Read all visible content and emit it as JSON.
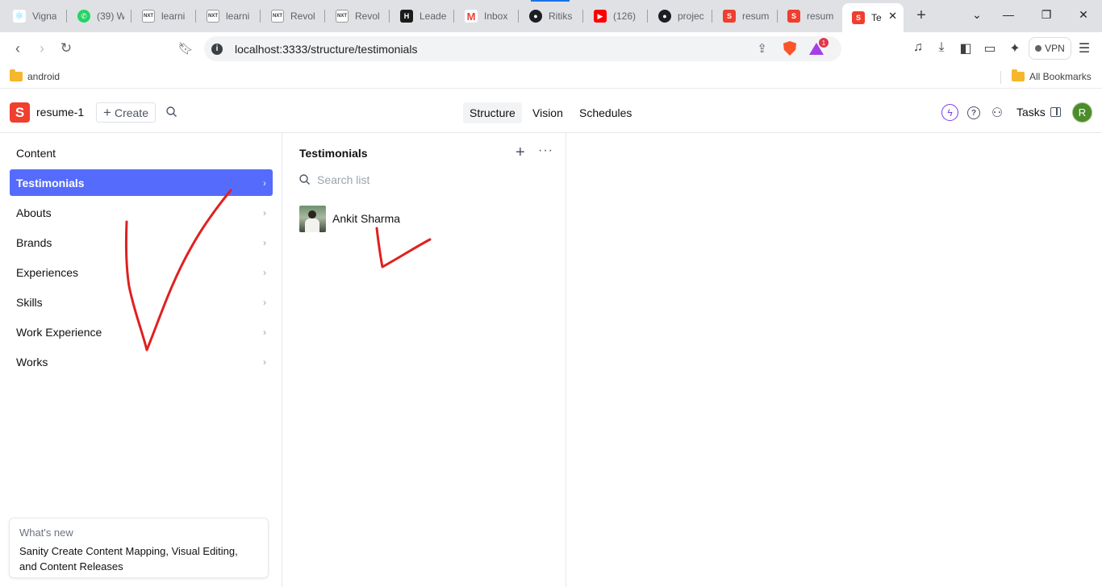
{
  "browser": {
    "tabs": [
      {
        "title": "Vigna",
        "favicon": "react"
      },
      {
        "title": "(39) W",
        "favicon": "whatsapp"
      },
      {
        "title": "learni",
        "favicon": "nxtwave"
      },
      {
        "title": "learni",
        "favicon": "nxtwave"
      },
      {
        "title": "Revol",
        "favicon": "nxtwave"
      },
      {
        "title": "Revol",
        "favicon": "nxtwave"
      },
      {
        "title": "Leade",
        "favicon": "hackerrank"
      },
      {
        "title": "Inbox",
        "favicon": "gmail"
      },
      {
        "title": "Ritiks",
        "favicon": "github"
      },
      {
        "title": "(126)",
        "favicon": "youtube"
      },
      {
        "title": "projec",
        "favicon": "github"
      },
      {
        "title": "resum",
        "favicon": "sanity"
      },
      {
        "title": "resum",
        "favicon": "sanity"
      },
      {
        "title": "Te",
        "favicon": "sanity",
        "active": true
      }
    ],
    "url": "localhost:3333/structure/testimonials",
    "vpn_label": "VPN",
    "reward_badge": "1",
    "bookmarks": [
      {
        "label": "android"
      }
    ],
    "all_bookmarks_label": "All Bookmarks"
  },
  "sanity": {
    "logo_letter": "S",
    "workspace": "resume-1",
    "create_label": "Create",
    "nav_tabs": [
      "Structure",
      "Vision",
      "Schedules"
    ],
    "active_tab": "Structure",
    "tasks_label": "Tasks",
    "avatar_initial": "R",
    "accent_color": "#556bfc",
    "brand_color": "#f03e2f"
  },
  "content_pane": {
    "title": "Content",
    "items": [
      {
        "label": "Testimonials",
        "selected": true
      },
      {
        "label": "Abouts"
      },
      {
        "label": "Brands"
      },
      {
        "label": "Experiences"
      },
      {
        "label": "Skills"
      },
      {
        "label": "Work Experience"
      },
      {
        "label": "Works"
      }
    ]
  },
  "list_pane": {
    "title": "Testimonials",
    "search_placeholder": "Search list",
    "documents": [
      {
        "name": "Ankit Sharma"
      }
    ]
  },
  "whats_new": {
    "title": "What's new",
    "body": "Sanity Create Content Mapping, Visual Editing, and Content Releases"
  },
  "annotation_color": "#e02020"
}
